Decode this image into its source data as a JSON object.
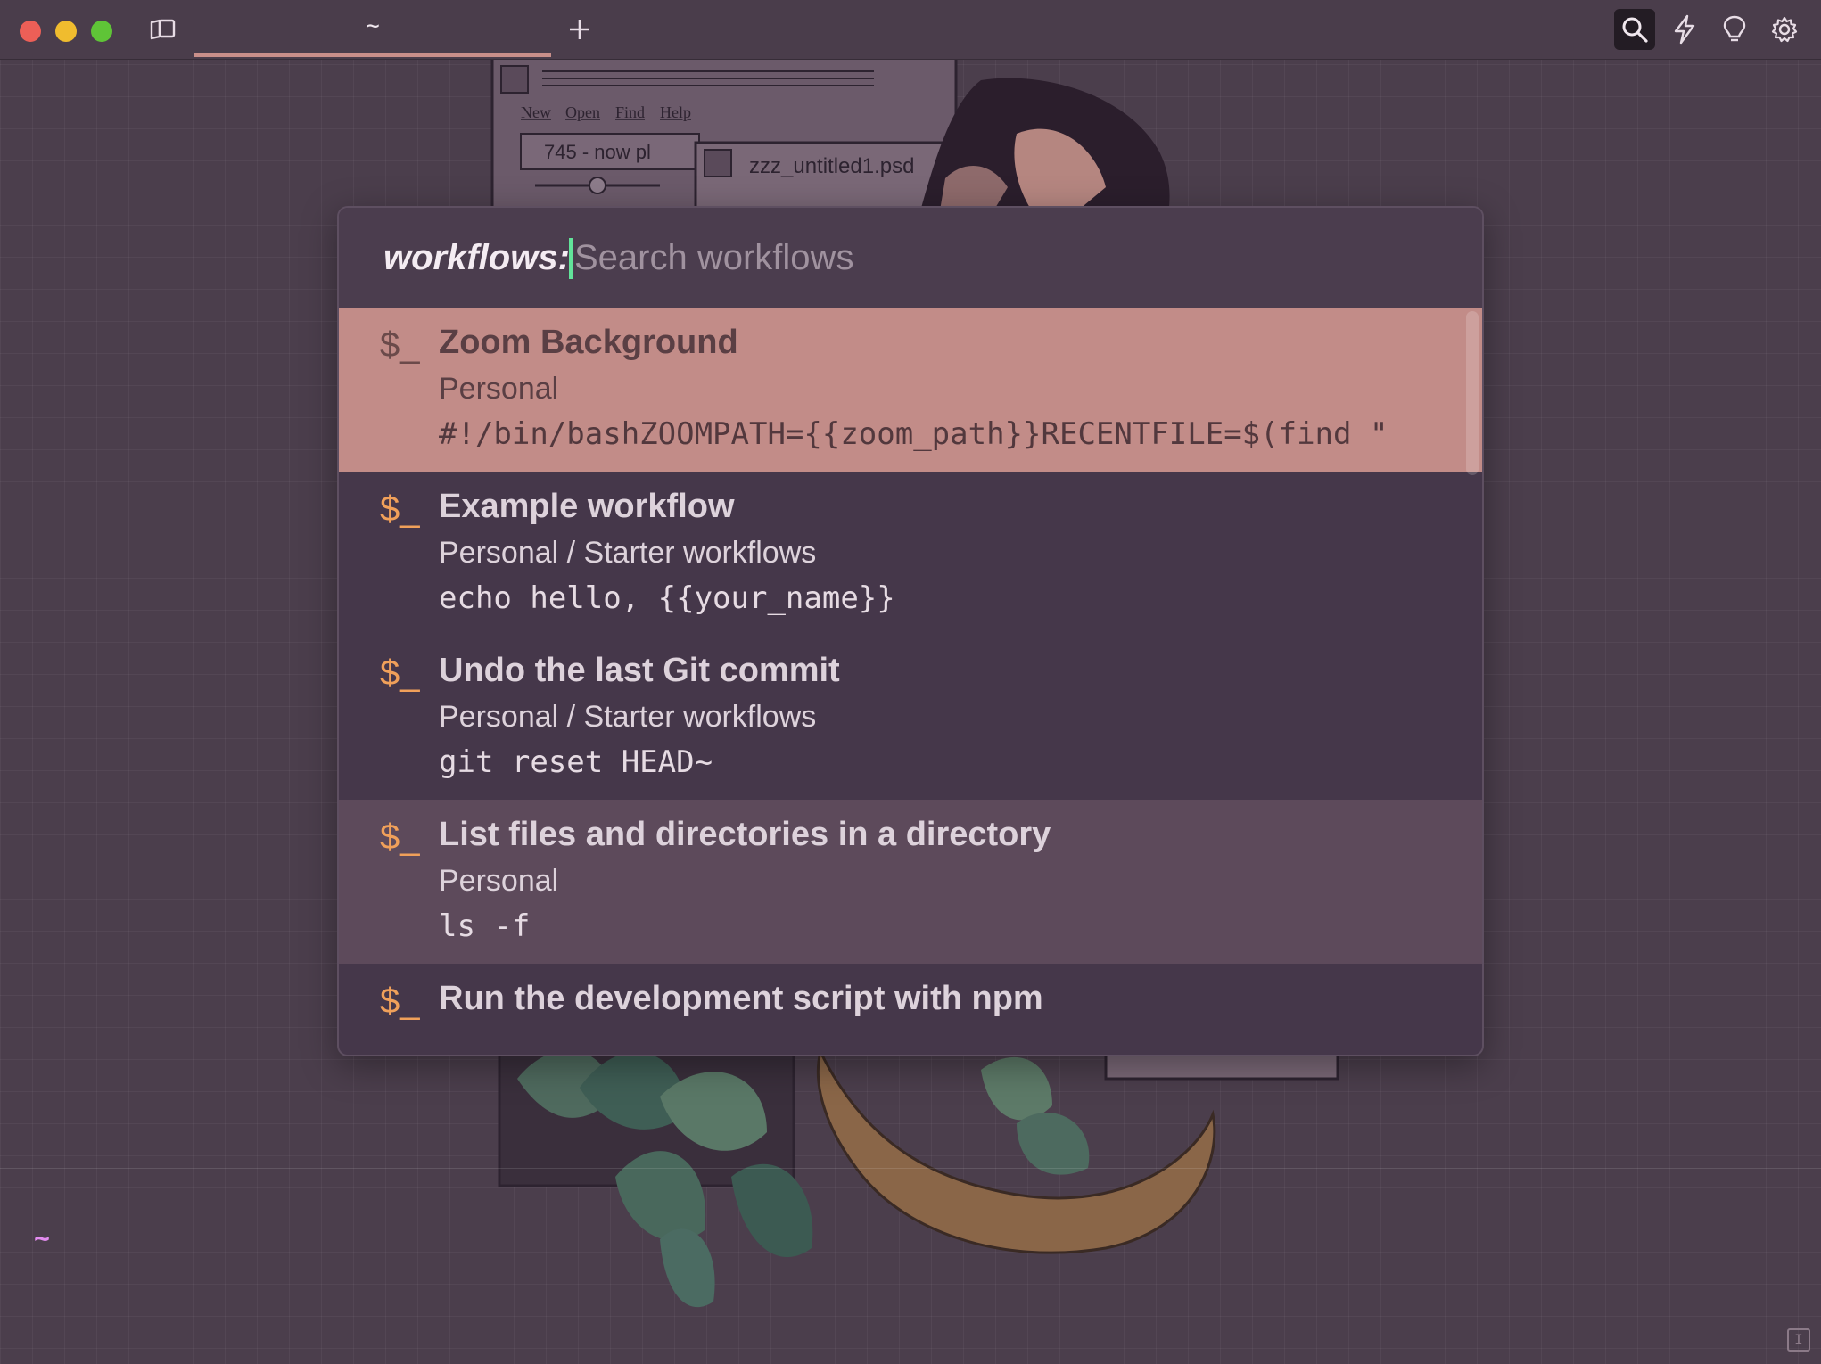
{
  "titlebar": {
    "tab_label": "~",
    "new_tab_symbol": "+",
    "icons": [
      "sidebar-icon",
      "search-icon",
      "lightning-icon",
      "lightbulb-icon",
      "gear-icon"
    ]
  },
  "background_art": {
    "window_menu": [
      "New",
      "Open",
      "Find",
      "Help"
    ],
    "track_text": "745 - now pl",
    "psd_title": "zzz_untitled1.psd"
  },
  "palette": {
    "prefix": "workflows:",
    "search_placeholder": "Search workflows",
    "search_value": "",
    "items": [
      {
        "icon": "$_",
        "name": "Zoom Background",
        "folder": "Personal",
        "command": "#!/bin/bashZOOMPATH={{zoom_path}}RECENTFILE=$(find \"",
        "state": "selected"
      },
      {
        "icon": "$_",
        "name": "Example workflow",
        "folder": "Personal / Starter workflows",
        "command": "echo hello, {{your_name}}",
        "state": "normal"
      },
      {
        "icon": "$_",
        "name": "Undo the last Git commit",
        "folder": "Personal / Starter workflows",
        "command": "git reset HEAD~",
        "state": "normal"
      },
      {
        "icon": "$_",
        "name": "List files and directories in a directory",
        "folder": "Personal",
        "command": "ls -f",
        "state": "hovered"
      },
      {
        "icon": "$_",
        "name": "Run the development script with npm",
        "folder": "",
        "command": "",
        "state": "normal"
      }
    ]
  },
  "prompt": {
    "text": "~"
  },
  "colors": {
    "background": "#4b3e4c",
    "selected_row": "#c28c88",
    "hovered_row": "#5d4a5b",
    "accent_orange": "#f0a05a",
    "cursor_green": "#62e39a",
    "prompt_pink": "#e38cf0"
  }
}
